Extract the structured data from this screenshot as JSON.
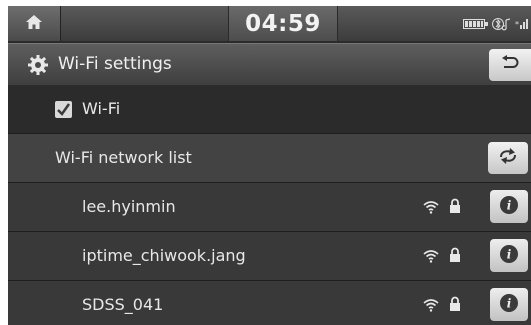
{
  "status_bar": {
    "home_icon": "home-icon",
    "time": "04:59",
    "icons": [
      "battery-icon",
      "bluetooth-audio-icon",
      "signal-icon"
    ]
  },
  "title_bar": {
    "icon": "gear-icon",
    "title": "Wi-Fi settings",
    "back_icon": "back-arrow-icon"
  },
  "wifi_toggle": {
    "label": "Wi-Fi",
    "checked": true
  },
  "network_list": {
    "header": "Wi-Fi network list",
    "refresh_icon": "refresh-icon",
    "networks": [
      {
        "ssid": "lee.hyinmin",
        "signal_icon": "wifi-signal-icon",
        "secured_icon": "lock-icon",
        "info_icon": "info-icon"
      },
      {
        "ssid": "iptime_chiwook.jang",
        "signal_icon": "wifi-signal-icon",
        "secured_icon": "lock-icon",
        "info_icon": "info-icon"
      },
      {
        "ssid": "SDSS_041",
        "signal_icon": "wifi-signal-icon",
        "secured_icon": "lock-icon",
        "info_icon": "info-icon"
      }
    ]
  },
  "colors": {
    "background": "#2b2b2b",
    "header_row": "#434343",
    "text": "#e8e8e8",
    "button": "#dcdcdc"
  }
}
